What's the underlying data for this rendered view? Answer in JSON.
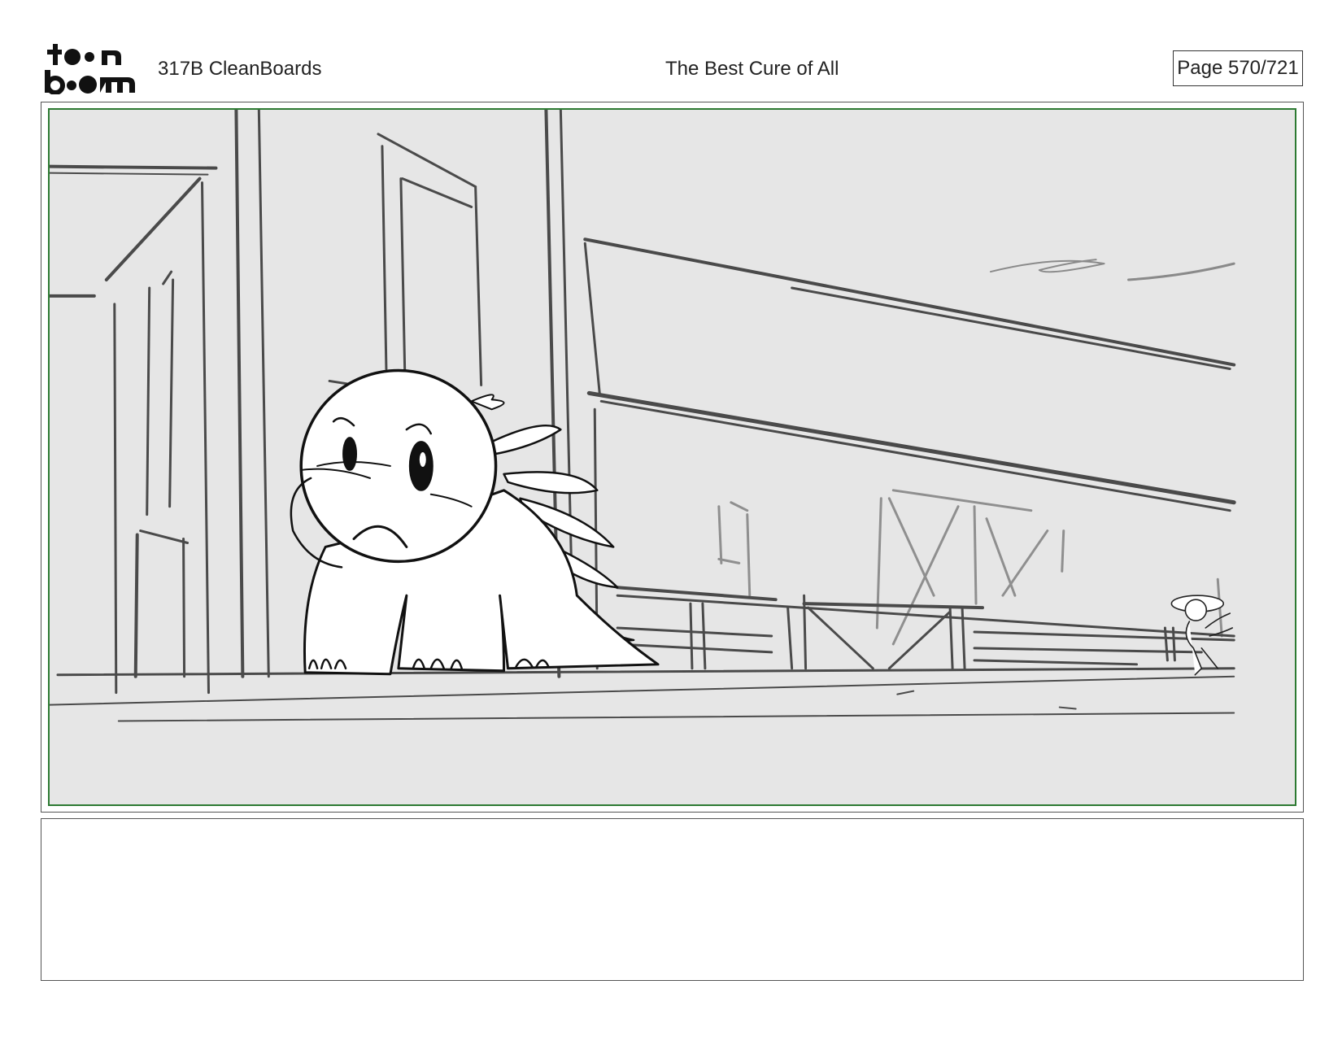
{
  "header": {
    "logo_top": "to•n",
    "logo_bottom": "b•om",
    "scene_id": "317B  CleanBoards",
    "title": "The Best Cure of All",
    "page": "Page 570/721"
  },
  "panel": {
    "frame_color": "#2d7a32",
    "background_color": "#e6e6e6"
  },
  "notes": {
    "text": ""
  }
}
